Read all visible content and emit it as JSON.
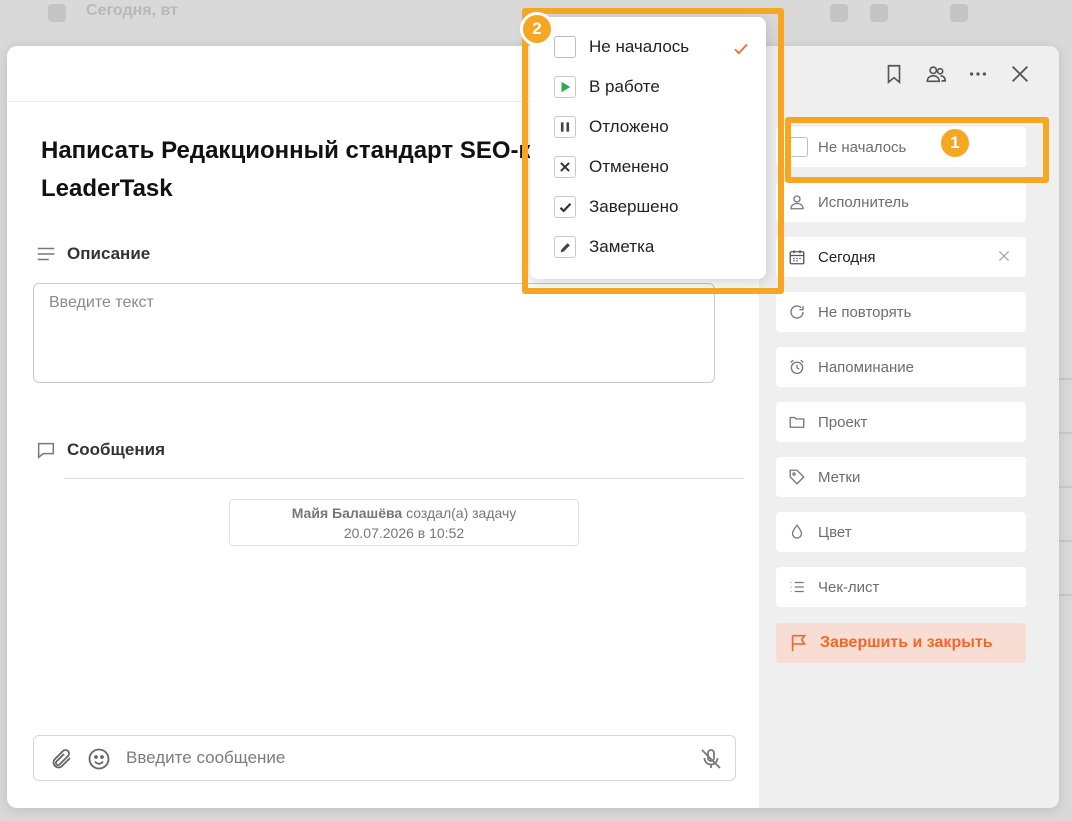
{
  "background": {
    "row_text": "Сегодня, вт"
  },
  "task": {
    "title": "Написать Редакционный стандарт SEO-к\nLeaderTask",
    "title_line1": "Написать Редакционный стандарт SEO-к",
    "title_line2": "LeaderTask"
  },
  "description": {
    "heading": "Описание",
    "placeholder": "Введите текст"
  },
  "messages": {
    "heading": "Сообщения",
    "log_author": "Майя Балашёва",
    "log_action": " создал(а) задачу",
    "log_time": "20.07.2026 в 10:52",
    "input_placeholder": "Введите сообщение"
  },
  "topbar": {
    "icons": [
      "bookmark-icon",
      "users-icon",
      "more-icon",
      "close-icon"
    ]
  },
  "sidebar": {
    "status_label": "Не началось",
    "assignee_label": "Исполнитель",
    "date_label": "Сегодня",
    "repeat_label": "Не повторять",
    "reminder_label": "Напоминание",
    "project_label": "Проект",
    "tags_label": "Метки",
    "color_label": "Цвет",
    "checklist_label": "Чек-лист",
    "finish_label": "Завершить и закрыть"
  },
  "status_dropdown": {
    "items": [
      {
        "label": "Не началось",
        "icon": "empty-checkbox-icon",
        "selected": true
      },
      {
        "label": "В работе",
        "icon": "play-icon",
        "selected": false
      },
      {
        "label": "Отложено",
        "icon": "pause-icon",
        "selected": false
      },
      {
        "label": "Отменено",
        "icon": "cancel-x-icon",
        "selected": false
      },
      {
        "label": "Завершено",
        "icon": "checkmark-icon",
        "selected": false
      },
      {
        "label": "Заметка",
        "icon": "pencil-icon",
        "selected": false
      }
    ]
  },
  "annotations": {
    "badge1": "1",
    "badge2": "2"
  },
  "colors": {
    "accent_orange": "#f5a623",
    "finish_text": "#f2672a",
    "finish_bg": "#f7ddd3",
    "play_green": "#2eaa4a",
    "check_orange": "#f26a2a"
  }
}
